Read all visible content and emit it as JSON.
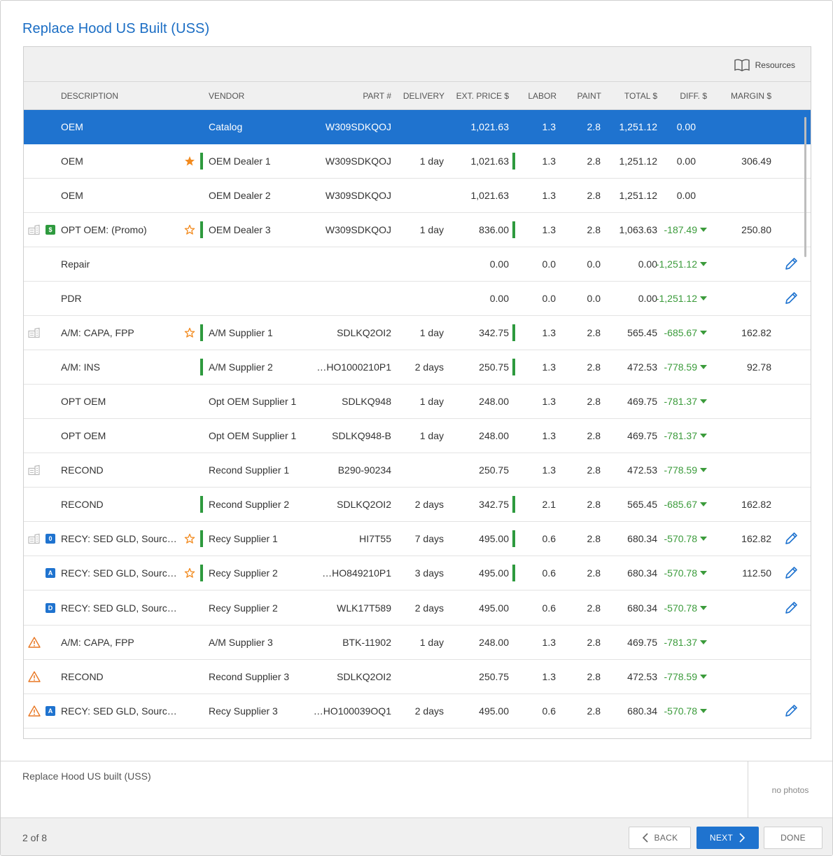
{
  "dialog": {
    "title": "Replace Hood US Built (USS)"
  },
  "toolbar": {
    "resources_label": "Resources",
    "resources_icon": "book-icon"
  },
  "columns": {
    "description": "DESCRIPTION",
    "vendor": "VENDOR",
    "part": "PART #",
    "delivery": "DELIVERY",
    "ext_price": "EXT. PRICE $",
    "labor": "LABOR",
    "paint": "PAINT",
    "total": "TOTAL $",
    "diff": "DIFF. $",
    "margin": "MARGIN $"
  },
  "colors": {
    "accent": "#1f73cf",
    "title": "#1a6dc4",
    "positive_green": "#2e9a3e",
    "diff_green": "#3b9b3b",
    "star_orange": "#f28a1e",
    "warning_orange": "#e87722"
  },
  "rows": [
    {
      "description": "OEM",
      "vendor": "Catalog",
      "part": "W309SDKQOJ",
      "delivery": "",
      "ext_price": "1,021.63",
      "labor": "1.3",
      "paint": "2.8",
      "total": "1,251.12",
      "diff": "0.00",
      "margin": ""
    },
    {
      "description": "OEM",
      "vendor": "OEM Dealer 1",
      "part": "W309SDKQOJ",
      "delivery": "1 day",
      "ext_price": "1,021.63",
      "labor": "1.3",
      "paint": "2.8",
      "total": "1,251.12",
      "diff": "0.00",
      "margin": "306.49"
    },
    {
      "description": "OEM",
      "vendor": "OEM Dealer 2",
      "part": "W309SDKQOJ",
      "delivery": "",
      "ext_price": "1,021.63",
      "labor": "1.3",
      "paint": "2.8",
      "total": "1,251.12",
      "diff": "0.00",
      "margin": ""
    },
    {
      "description": "OPT OEM: (Promo)",
      "vendor": "OEM Dealer 3",
      "part": "W309SDKQOJ",
      "delivery": "1 day",
      "ext_price": "836.00",
      "labor": "1.3",
      "paint": "2.8",
      "total": "1,063.63",
      "diff": "-187.49",
      "margin": "250.80",
      "badge": "$"
    },
    {
      "description": "Repair",
      "vendor": "",
      "part": "",
      "delivery": "",
      "ext_price": "0.00",
      "labor": "0.0",
      "paint": "0.0",
      "total": "0.00",
      "diff": "-1,251.12",
      "margin": ""
    },
    {
      "description": "PDR",
      "vendor": "",
      "part": "",
      "delivery": "",
      "ext_price": "0.00",
      "labor": "0.0",
      "paint": "0.0",
      "total": "0.00",
      "diff": "-1,251.12",
      "margin": ""
    },
    {
      "description": "A/M: CAPA, FPP",
      "vendor": "A/M Supplier 1",
      "part": "SDLKQ2OI2",
      "delivery": "1 day",
      "ext_price": "342.75",
      "labor": "1.3",
      "paint": "2.8",
      "total": "565.45",
      "diff": "-685.67",
      "margin": "162.82"
    },
    {
      "description": "A/M: INS",
      "vendor": "A/M Supplier 2",
      "part": "…HO1000210P1",
      "delivery": "2 days",
      "ext_price": "250.75",
      "labor": "1.3",
      "paint": "2.8",
      "total": "472.53",
      "diff": "-778.59",
      "margin": "92.78"
    },
    {
      "description": "OPT OEM",
      "vendor": "Opt OEM Supplier 1",
      "part": "SDLKQ948",
      "delivery": "1 day",
      "ext_price": "248.00",
      "labor": "1.3",
      "paint": "2.8",
      "total": "469.75",
      "diff": "-781.37",
      "margin": ""
    },
    {
      "description": "OPT OEM",
      "vendor": "Opt OEM Supplier 1",
      "part": "SDLKQ948-B",
      "delivery": "1 day",
      "ext_price": "248.00",
      "labor": "1.3",
      "paint": "2.8",
      "total": "469.75",
      "diff": "-781.37",
      "margin": ""
    },
    {
      "description": "RECOND",
      "vendor": "Recond Supplier 1",
      "part": "B290-90234",
      "delivery": "",
      "ext_price": "250.75",
      "labor": "1.3",
      "paint": "2.8",
      "total": "472.53",
      "diff": "-778.59",
      "margin": ""
    },
    {
      "description": "RECOND",
      "vendor": "Recond Supplier 2",
      "part": "SDLKQ2OI2",
      "delivery": "2 days",
      "ext_price": "342.75",
      "labor": "2.1",
      "paint": "2.8",
      "total": "565.45",
      "diff": "-685.67",
      "margin": "162.82"
    },
    {
      "description": "RECY: SED GLD, Source VI…",
      "vendor": "Recy Supplier 1",
      "part": "HI7T55",
      "delivery": "7 days",
      "ext_price": "495.00",
      "labor": "0.6",
      "paint": "2.8",
      "total": "680.34",
      "diff": "-570.78",
      "margin": "162.82",
      "badge": "0"
    },
    {
      "description": "RECY: SED GLD, Source VI…",
      "vendor": "Recy Supplier 2",
      "part": "…HO849210P1",
      "delivery": "3 days",
      "ext_price": "495.00",
      "labor": "0.6",
      "paint": "2.8",
      "total": "680.34",
      "diff": "-570.78",
      "margin": "112.50",
      "badge": "A"
    },
    {
      "description": "RECY: SED GLD, Source VI…",
      "vendor": "Recy Supplier 2",
      "part": "WLK17T589",
      "delivery": "2 days",
      "ext_price": "495.00",
      "labor": "0.6",
      "paint": "2.8",
      "total": "680.34",
      "diff": "-570.78",
      "margin": "",
      "badge": "D"
    },
    {
      "description": "A/M: CAPA, FPP",
      "vendor": "A/M Supplier 3",
      "part": "BTK-11902",
      "delivery": "1 day",
      "ext_price": "248.00",
      "labor": "1.3",
      "paint": "2.8",
      "total": "469.75",
      "diff": "-781.37",
      "margin": ""
    },
    {
      "description": "RECOND",
      "vendor": "Recond Supplier 3",
      "part": "SDLKQ2OI2",
      "delivery": "",
      "ext_price": "250.75",
      "labor": "1.3",
      "paint": "2.8",
      "total": "472.53",
      "diff": "-778.59",
      "margin": ""
    },
    {
      "description": "RECY: SED GLD, Source VI…",
      "vendor": "Recy Supplier 3",
      "part": "…HO100039OQ1",
      "delivery": "2 days",
      "ext_price": "495.00",
      "labor": "0.6",
      "paint": "2.8",
      "total": "680.34",
      "diff": "-570.78",
      "margin": "",
      "badge": "A"
    }
  ],
  "notes": {
    "text": "Replace Hood US built (USS)",
    "photos_label": "no photos"
  },
  "footer": {
    "pager": "2 of 8",
    "back_label": "BACK",
    "next_label": "NEXT",
    "done_label": "DONE"
  }
}
